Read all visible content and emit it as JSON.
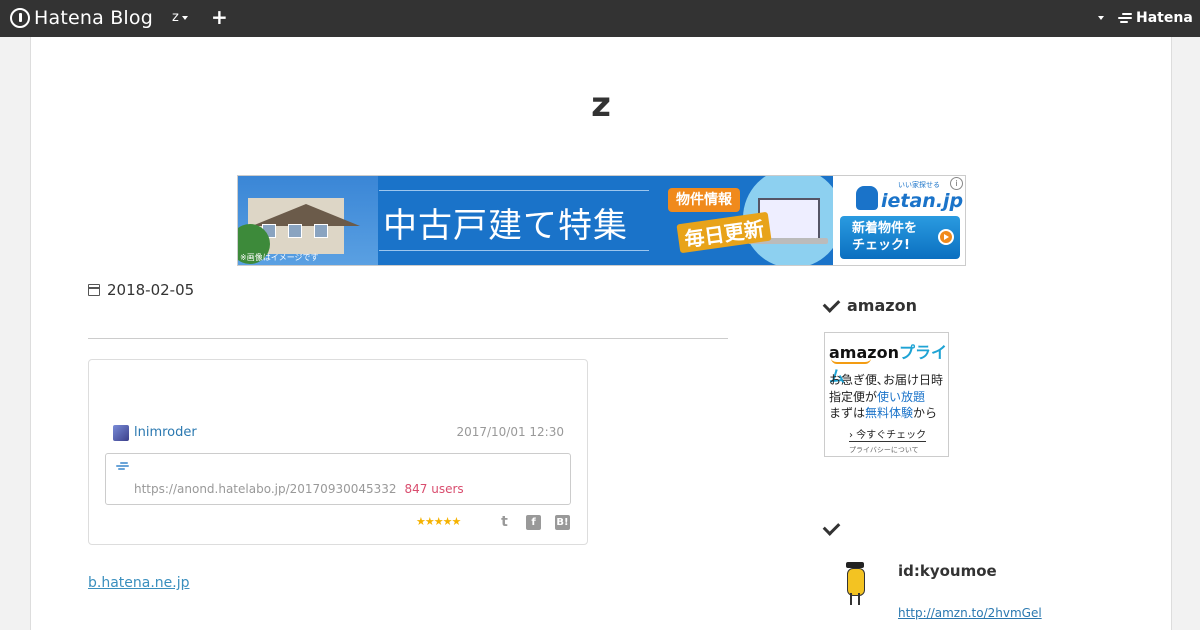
{
  "topbar": {
    "brand": "Hatena Blog",
    "blog_menu_label": "z",
    "add_label": "+",
    "hatena_label": "Hatena"
  },
  "blog": {
    "title": "z"
  },
  "ad": {
    "headline": "中古戸建て特集",
    "badge": "物件情報",
    "daily": "毎日更新",
    "photo_note": "※画像はイメージです",
    "brand": "ietan.jp",
    "brand_tagline": "いい家探せる",
    "cta": "新着物件を\nチェック!",
    "info": "i"
  },
  "entry": {
    "date": "2018-02-05",
    "embed": {
      "user": "lnimroder",
      "time": "2017/10/01 12:30",
      "url": "https://anond.hatelabo.jp/20170930045332",
      "users": "847 users",
      "stars": "★★★★★",
      "share_twitter": "t",
      "share_facebook": "f",
      "share_hatebu": "B!"
    },
    "link_text": "b.hatena.ne.jp"
  },
  "sidebar": {
    "amazon": {
      "title": "amazon",
      "logo": "amazon",
      "logo_prime": "プライム",
      "line1": "お急ぎ便､お届け日時",
      "line2_a": "指定便が",
      "line2_b": "使い放題",
      "line3_a": "まずは",
      "line3_b": "無料体験",
      "line3_c": "から",
      "cta": "› 今すぐチェック",
      "privacy": "プライバシーについて"
    },
    "profile": {
      "id": "id:kyoumoe",
      "link": "http://amzn.to/2hvmGel"
    }
  }
}
